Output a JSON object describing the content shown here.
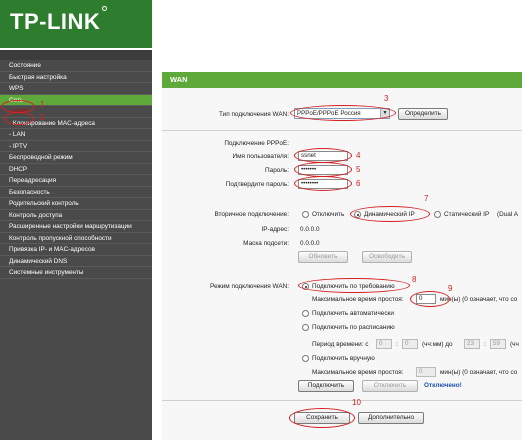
{
  "header": {
    "logo_text": "TP-LINK"
  },
  "sidebar": {
    "items": [
      {
        "label": "Состояние"
      },
      {
        "label": "Быстрая настройка"
      },
      {
        "label": "WPS"
      },
      {
        "label": "Сеть"
      },
      {
        "label": "- WAN"
      },
      {
        "label": "- Клонирование MAC-адреса"
      },
      {
        "label": "- LAN"
      },
      {
        "label": "- IPTV"
      },
      {
        "label": "Беспроводной режим"
      },
      {
        "label": "DHCP"
      },
      {
        "label": "Переадресация"
      },
      {
        "label": "Безопасность"
      },
      {
        "label": "Родительский контроль"
      },
      {
        "label": "Контроль доступа"
      },
      {
        "label": "Расширенные настройки маршрутизации"
      },
      {
        "label": "Контроль пропускной способности"
      },
      {
        "label": "Привязка IP- и MAC-адресов"
      },
      {
        "label": "Динамический DNS"
      },
      {
        "label": "Системные инструменты"
      }
    ]
  },
  "main": {
    "title": "WAN",
    "wan_type_label": "Тип подключения WAN:",
    "wan_type_value": "PPPoE/PPPoE Россия",
    "detect_button": "Определить",
    "pppoe_header": "Подключение PPPoE:",
    "username_label": "Имя пользователя:",
    "username_value": "ssnet",
    "password_label": "Пароль:",
    "password_value": "•••••••",
    "confirm_label": "Подтвердите пароль:",
    "confirm_value": "••••••••",
    "secondary_label": "Вторичное подключение:",
    "secondary_options": [
      "Отключить",
      "Динамический IP",
      "Статический IP",
      "(Dual A"
    ],
    "ip_label": "IP-адрес:",
    "ip_value": "0.0.0.0",
    "mask_label": "Маска подсети:",
    "mask_value": "0.0.0.0",
    "refresh_button": "Обновить",
    "release_button": "Освободить",
    "mode_label": "Режим подключения WAN:",
    "mode_on_demand": "Подключить по требованию",
    "idle_label": "Максимальное время простоя:",
    "idle_value": "0",
    "idle_suffix": "мин(ы) (0 означает, что со",
    "mode_auto": "Подключить автоматически",
    "mode_schedule": "Подключить по расписанию",
    "period_label": "Период времени:  с",
    "period_from_h": "0",
    "period_from_m": "0",
    "period_sep": "(чч:мм) до",
    "period_to_h": "23",
    "period_to_m": "59",
    "period_suffix": "(чч",
    "colon": ":",
    "mode_manual": "Подключить вручную",
    "idle2_label": "Максимальное время простоя:",
    "idle2_value": "0",
    "idle2_suffix": "мин(ы) (0 означает, что со",
    "connect_button": "Подключить",
    "disconnect_button": "Отключить",
    "status_text": "Отключено!",
    "save_button": "Сохранить",
    "advanced_button": "Дополнительно"
  },
  "annotations": [
    "1",
    "2",
    "3",
    "4",
    "5",
    "6",
    "7",
    "8",
    "9",
    "10"
  ]
}
